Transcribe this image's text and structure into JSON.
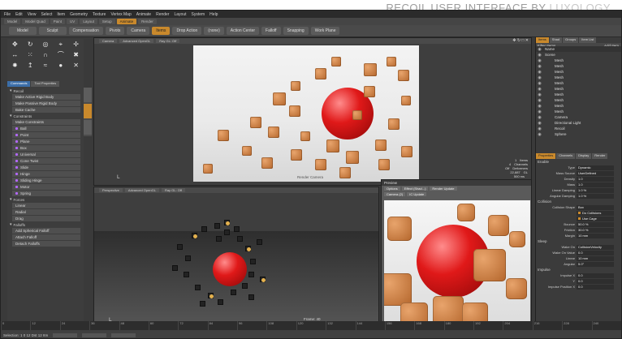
{
  "caption": {
    "text": "RECOIL USER INTERFACE BY",
    "brand": "LUXOLOGY"
  },
  "menubar": [
    "File",
    "Edit",
    "View",
    "Select",
    "Item",
    "Geometry",
    "Texture",
    "Vertex Map",
    "Animate",
    "Render",
    "Layout",
    "System",
    "Help"
  ],
  "layout_tabs": [
    {
      "label": "Model",
      "active": false
    },
    {
      "label": "Model Quad",
      "active": false
    },
    {
      "label": "Paint",
      "active": false
    },
    {
      "label": "UV",
      "active": false
    },
    {
      "label": "Layout",
      "active": false
    },
    {
      "label": "Setup",
      "active": false
    },
    {
      "label": "Animate",
      "active": true
    },
    {
      "label": "Render",
      "active": false
    }
  ],
  "toolbar": {
    "model": "Model",
    "sculpt": "Sculpt",
    "compensation": "Compensation",
    "pivots": "Pivots",
    "camera": "Camera",
    "items": "Items",
    "drop_action": "Drop Action",
    "none": "(none)",
    "action_center": "Action Center",
    "falloff": "Falloff",
    "snapping": "Snapping",
    "work_plane": "Work Plane"
  },
  "left": {
    "tabs": [
      "Commands",
      "Tool Properties"
    ],
    "sections": [
      {
        "title": "Recoil",
        "items": [
          {
            "label": "Make Active Rigid Body",
            "dot": false
          },
          {
            "label": "Make Passive Rigid Body",
            "dot": false
          },
          {
            "label": "Bake Cache",
            "dot": false
          }
        ]
      },
      {
        "title": "Constraints",
        "items": [
          {
            "label": "Make Constraints",
            "dot": false
          }
        ]
      },
      {
        "title": "",
        "items": [
          {
            "label": "Ball",
            "dot": true
          },
          {
            "label": "Point",
            "dot": true
          },
          {
            "label": "Plane",
            "dot": true
          },
          {
            "label": "Box",
            "dot": true
          },
          {
            "label": "Universal",
            "dot": true
          },
          {
            "label": "Cone Twist",
            "dot": true
          },
          {
            "label": "Slide",
            "dot": true
          },
          {
            "label": "Hinge",
            "dot": true
          },
          {
            "label": "Sliding Hinge",
            "dot": true
          }
        ]
      },
      {
        "title": "",
        "items": [
          {
            "label": "Motor",
            "dot": true
          },
          {
            "label": "Spring",
            "dot": true
          }
        ]
      },
      {
        "title": "Forces",
        "items": [
          {
            "label": "Linear",
            "dot": false
          },
          {
            "label": "Radial",
            "dot": false
          },
          {
            "label": "Drag",
            "dot": false
          }
        ]
      },
      {
        "title": "Falloffs",
        "items": [
          {
            "label": "Add Spherical Falloff",
            "dot": false
          },
          {
            "label": "Attach Falloff",
            "dot": false
          },
          {
            "label": "Detach Falloffs",
            "dot": false
          }
        ]
      }
    ]
  },
  "viewport_top": {
    "tabs": [
      "Camera",
      "Advanced OpenGL",
      "Ray GL: Off"
    ],
    "caption": "Render Camera"
  },
  "viewport_bottom": {
    "tabs": [
      "Perspective",
      "Advanced OpenGL",
      "Ray GL: Off"
    ],
    "frame": "Frame: 40"
  },
  "stats": [
    {
      "k": "Items",
      "v": "1"
    },
    {
      "k": "Channels",
      "v": "4"
    },
    {
      "k": "Deformers",
      "v": "Off"
    },
    {
      "k": "GL",
      "v": "22,887"
    },
    {
      "k": "",
      "v": "500 ms"
    }
  ],
  "preview": {
    "title": "Preview",
    "controls": [
      "Options",
      "Effect (Shad...)",
      "Render Update"
    ],
    "controls2": [
      "Camera (2)",
      "IC Update"
    ]
  },
  "right": {
    "tabs": [
      {
        "label": "Items",
        "active": true
      },
      {
        "label": "Shad",
        "active": false
      },
      {
        "label": "Groups",
        "active": false
      },
      {
        "label": "Item List",
        "active": false
      }
    ],
    "filter": "Filter Items",
    "add": "Add Item",
    "tree_header": "Name",
    "tree": [
      "Scene",
      "Mesh",
      "Mesh",
      "Mesh",
      "Mesh",
      "Mesh",
      "Mesh",
      "Mesh",
      "Mesh",
      "Mesh",
      "Mesh",
      "Camera",
      "Directional Light",
      "Recoil",
      "Sphere"
    ],
    "prop_tabs": [
      {
        "label": "Properties",
        "active": true
      },
      {
        "label": "Channels",
        "active": false
      },
      {
        "label": "Display",
        "active": false
      },
      {
        "label": "Render",
        "active": false
      }
    ],
    "props": [
      {
        "type": "sec",
        "label": "Enable"
      },
      {
        "type": "row",
        "label": "Type",
        "value": "Dynamic",
        "chk": false
      },
      {
        "type": "row",
        "label": "Mass Source",
        "value": "UserDefined",
        "chk": false
      },
      {
        "type": "row",
        "label": "Density",
        "value": "1.0",
        "chk": false
      },
      {
        "type": "row",
        "label": "Mass",
        "value": "1.0",
        "chk": false
      },
      {
        "type": "row",
        "label": "Linear Damping",
        "value": "1.0 %",
        "chk": false
      },
      {
        "type": "row",
        "label": "Angular Damping",
        "value": "1.0 %",
        "chk": false
      },
      {
        "type": "sec",
        "label": "Collision"
      },
      {
        "type": "row",
        "label": "Collision Shape",
        "value": "Box",
        "chk": false
      },
      {
        "type": "row",
        "label": "",
        "value": "Do Collisions",
        "chk": true
      },
      {
        "type": "row",
        "label": "",
        "value": "Use Cage",
        "chk": true
      },
      {
        "type": "row",
        "label": "Bounce",
        "value": "50.0 %",
        "chk": false
      },
      {
        "type": "row",
        "label": "Friction",
        "value": "30.0 %",
        "chk": false
      },
      {
        "type": "row",
        "label": "Margin",
        "value": "10 mm",
        "chk": false
      },
      {
        "type": "sec",
        "label": "Sleep"
      },
      {
        "type": "row",
        "label": "Wake On",
        "value": "CollisionVelocity",
        "chk": false
      },
      {
        "type": "row",
        "label": "Wake On Value",
        "value": "0.0",
        "chk": false
      },
      {
        "type": "row",
        "label": "Linear",
        "value": "10 mm",
        "chk": false
      },
      {
        "type": "row",
        "label": "Angular",
        "value": "5.0°",
        "chk": false
      },
      {
        "type": "sec",
        "label": "Impulse"
      },
      {
        "type": "row",
        "label": "Impulse X",
        "value": "0.0",
        "chk": false
      },
      {
        "type": "row",
        "label": "Y",
        "value": "0.0",
        "chk": false
      },
      {
        "type": "row",
        "label": "Impulse Position X",
        "value": "0.0",
        "chk": false
      }
    ]
  },
  "timeline": [
    "0",
    "12",
    "24",
    "36",
    "48",
    "60",
    "72",
    "84",
    "96",
    "108",
    "120",
    "132",
    "144",
    "156",
    "168",
    "180",
    "192",
    "204",
    "216",
    "228",
    "240"
  ],
  "status": {
    "left": "Selection: 1  0  12  Dst  12  Itm"
  }
}
